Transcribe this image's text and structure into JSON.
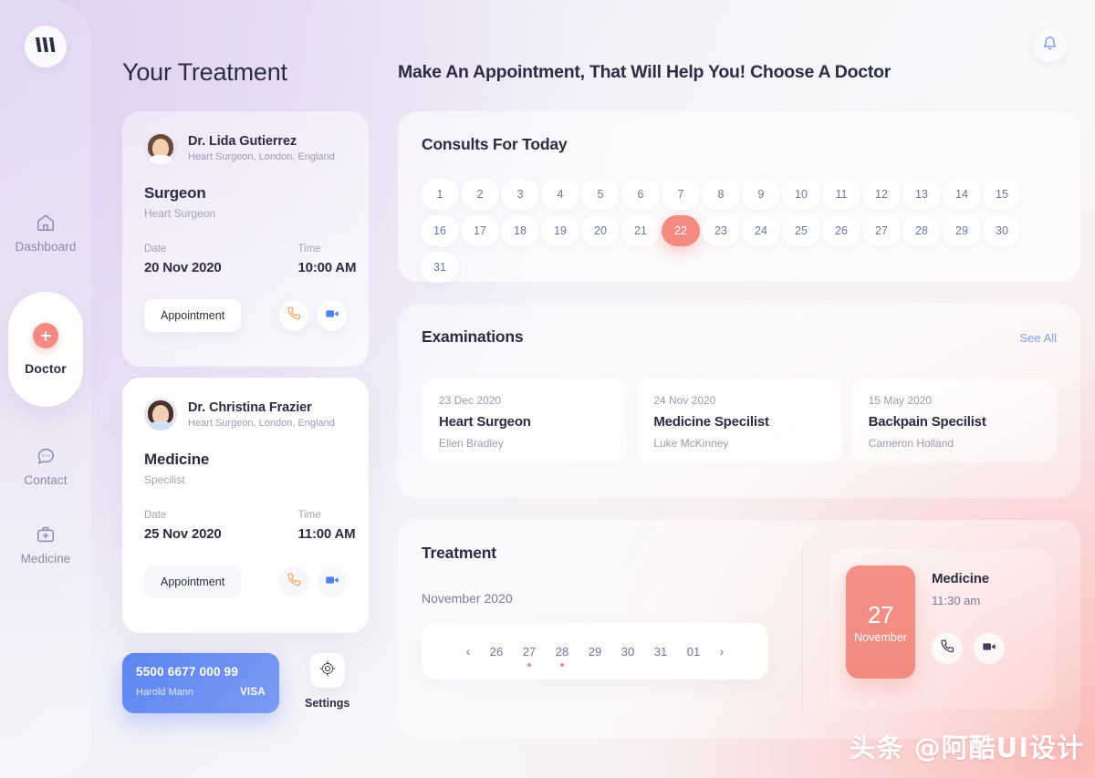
{
  "brand": {
    "logo_icon": "wm-monogram-logo"
  },
  "sidebar": {
    "items": [
      {
        "icon": "home-icon",
        "label": "Dashboard",
        "active": false
      },
      {
        "icon": "plus-circle-icon",
        "label": "Doctor",
        "active": true
      },
      {
        "icon": "chat-bubble-icon",
        "label": "Contact",
        "active": false
      },
      {
        "icon": "medical-kit-icon",
        "label": "Medicine",
        "active": false
      }
    ]
  },
  "left_panel": {
    "title": "Your Treatment",
    "doctors": [
      {
        "name": "Dr. Lida Gutierrez",
        "subtitle": "Heart Surgeon, London, England",
        "specialty": "Surgeon",
        "specialty_sub": "Heart Surgeon",
        "date_label": "Date",
        "date_value": "20 Nov 2020",
        "time_label": "Time",
        "time_value": "10:00 AM",
        "appointment_label": "Appointment",
        "phone_icon": "phone-icon",
        "video_icon": "video-camera-icon"
      },
      {
        "name": "Dr. Christina Frazier",
        "subtitle": "Heart Surgeon, London, England",
        "specialty": "Medicine",
        "specialty_sub": "Specilist",
        "date_label": "Date",
        "date_value": "25 Nov 2020",
        "time_label": "Time",
        "time_value": "11:00 AM",
        "appointment_label": "Appointment",
        "phone_icon": "phone-icon",
        "video_icon": "video-camera-icon"
      }
    ],
    "credit_card": {
      "number": "5500 6677 000 99",
      "holder": "Harold Mann",
      "brand": "VISA"
    },
    "settings": {
      "label": "Settings",
      "icon": "gear-icon"
    }
  },
  "main": {
    "notification_icon": "bell-icon",
    "title": "Make An Appointment, That Will Help You! Choose A Doctor",
    "consults": {
      "heading": "Consults For Today",
      "days_row1": [
        "1",
        "2",
        "3",
        "4",
        "5",
        "6",
        "7",
        "8",
        "9",
        "10",
        "11",
        "12",
        "13",
        "14",
        "15",
        "16"
      ],
      "days_row2": [
        "17",
        "18",
        "19",
        "20",
        "21",
        "22",
        "23",
        "24",
        "25",
        "26",
        "27",
        "28",
        "29",
        "30",
        "31"
      ],
      "selected_day": "22"
    },
    "examinations": {
      "heading": "Examinations",
      "see_all": "See All",
      "items": [
        {
          "date": "23 Dec 2020",
          "title": "Heart Surgeon",
          "person": "Ellen Bradley"
        },
        {
          "date": "24 Nov 2020",
          "title": "Medicine Specilist",
          "person": "Luke McKinney"
        },
        {
          "date": "15 May 2020",
          "title": "Backpain Specilist",
          "person": "Cameron Holland"
        }
      ]
    },
    "treatment": {
      "heading": "Treatment",
      "month": "November 2020",
      "prev_icon": "chevron-left-icon",
      "next_icon": "chevron-right-icon",
      "strip_days": [
        {
          "day": "26",
          "dot": false
        },
        {
          "day": "27",
          "dot": true
        },
        {
          "day": "28",
          "dot": true
        },
        {
          "day": "29",
          "dot": false
        },
        {
          "day": "30",
          "dot": false
        },
        {
          "day": "31",
          "dot": false
        },
        {
          "day": "01",
          "dot": false
        }
      ],
      "appointment": {
        "day": "27",
        "month": "November",
        "title": "Medicine",
        "time": "11:30 am",
        "phone_icon": "phone-icon",
        "video_icon": "video-camera-icon"
      }
    }
  },
  "watermark": {
    "text": "头条 @阿酷UI设计"
  },
  "colors": {
    "accent_coral": "#f48a80",
    "accent_blue": "#5b86f0",
    "link_blue": "#7ea2f5",
    "text_dark": "#2b2d45",
    "text_muted": "#9a9ab4",
    "phone_orange": "#f9a35c",
    "video_blue": "#4d82f3"
  }
}
